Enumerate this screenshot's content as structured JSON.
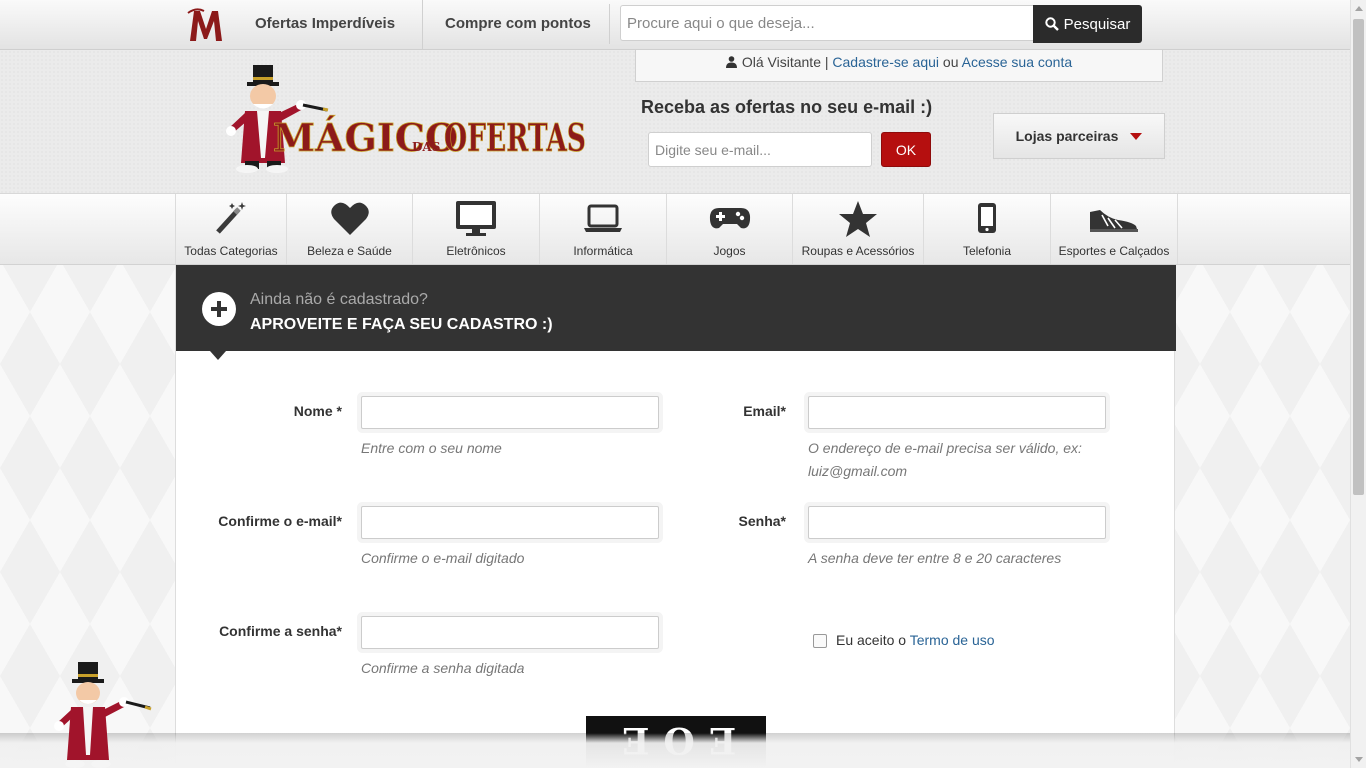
{
  "topbar": {
    "logo_letter": "M",
    "links": [
      "Ofertas Imperdíveis",
      "Compre com pontos"
    ],
    "search_placeholder": "Procure aqui o que deseja...",
    "search_button": "Pesquisar"
  },
  "header": {
    "welcome_greeting": "Olá Visitante |",
    "signup_link": "Cadastre-se aqui",
    "or_text": "ou",
    "login_link": "Acesse sua conta",
    "brand_text_1": "MÁGICO",
    "brand_text_2": "DAS",
    "brand_text_3": "OFERTAS",
    "newsletter_title": "Receba as ofertas no seu e-mail :)",
    "newsletter_placeholder": "Digite seu e-mail...",
    "newsletter_button": "OK",
    "partners_label": "Lojas parceiras"
  },
  "categories": [
    {
      "label": "Todas Categorias",
      "icon": "magic-wand-icon"
    },
    {
      "label": "Beleza e Saúde",
      "icon": "heart-icon"
    },
    {
      "label": "Eletrônicos",
      "icon": "monitor-icon"
    },
    {
      "label": "Informática",
      "icon": "laptop-icon"
    },
    {
      "label": "Jogos",
      "icon": "gamepad-icon"
    },
    {
      "label": "Roupas e Acessórios",
      "icon": "star-icon"
    },
    {
      "label": "Telefonia",
      "icon": "phone-icon"
    },
    {
      "label": "Esportes e Calçados",
      "icon": "sneaker-icon"
    }
  ],
  "form": {
    "subtitle": "Ainda não é cadastrado?",
    "title": "APROVEITE E FAÇA SEU CADASTRO :)",
    "name_label": "Nome *",
    "name_help": "Entre com o seu nome",
    "email_label": "Email*",
    "email_help": "O endereço de e-mail precisa ser válido, ex: luiz@gmail.com",
    "confirm_email_label": "Confirme o e-mail*",
    "confirm_email_help": "Confirme o e-mail digitado",
    "password_label": "Senha*",
    "password_help": "A senha deve ter entre 8 e 20 caracteres",
    "confirm_password_label": "Confirme a senha*",
    "confirm_password_help": "Confirme a senha digitada",
    "terms_prefix": "Eu aceito o",
    "terms_link": "Termo de uso",
    "captcha_text": "EOE"
  },
  "colors": {
    "accent_red": "#b50f0f",
    "dark_header": "#333333",
    "link_blue": "#2a6496"
  }
}
